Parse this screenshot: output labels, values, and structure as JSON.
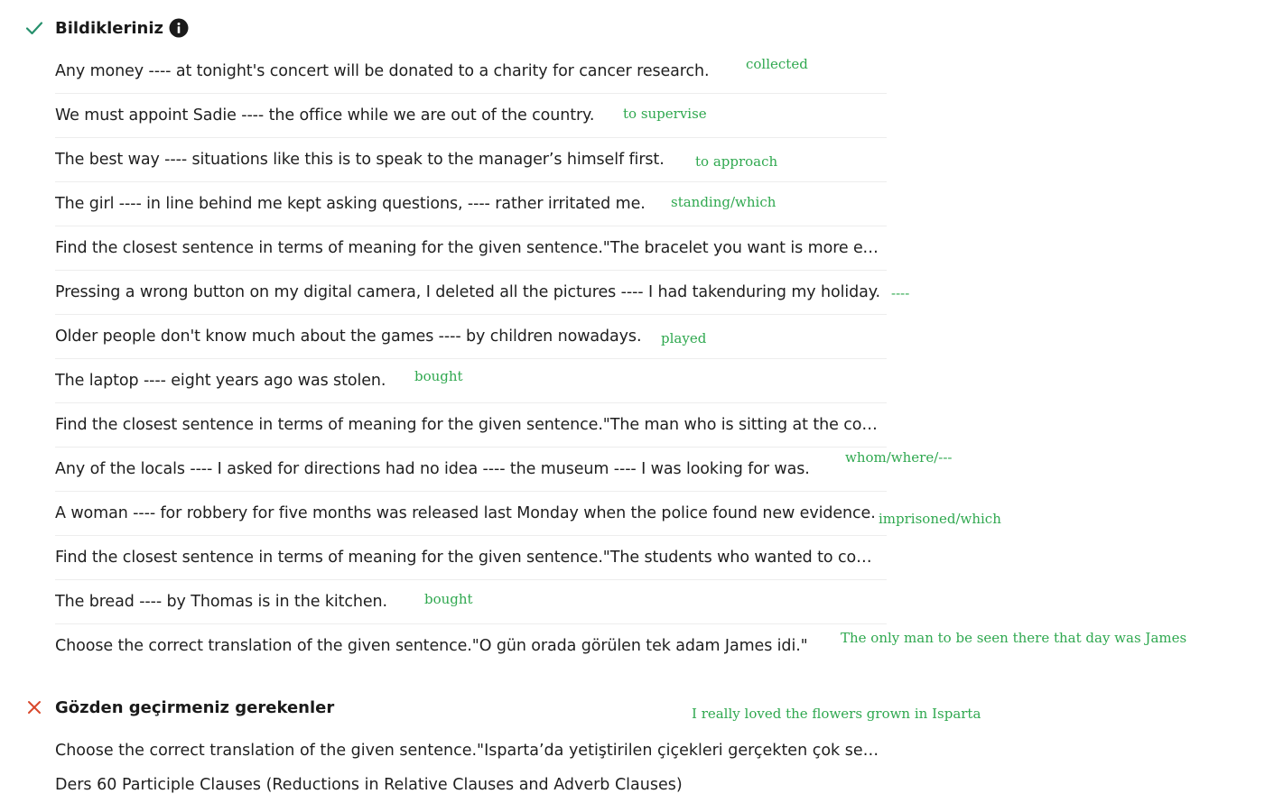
{
  "known_section": {
    "title": "Bildikleriniz",
    "check_icon": "check-icon",
    "info_icon": "info-icon",
    "accent_color": "#26906c"
  },
  "questions": [
    {
      "text": "Any money ---- at tonight's concert will be donated to a charity for cancer research.",
      "note": "collected"
    },
    {
      "text": "We must appoint Sadie ---- the office while we are out of the country.",
      "note": "to supervise"
    },
    {
      "text": "The best way ---- situations like this is to speak to the manager’s himself first.",
      "note": "to approach"
    },
    {
      "text": "The girl ---- in line behind me kept asking questions, ---- rather irritated me.",
      "note": "standing/which"
    },
    {
      "text": "Find the closest sentence in terms of meaning for the given sentence.\"The bracelet you want is more expensive than the one I have.\"",
      "note": ""
    },
    {
      "text": "Pressing a wrong button on my digital camera, I deleted all the pictures ---- I had takenduring my holiday.",
      "note": "----"
    },
    {
      "text": "Older people don't know much about the games ---- by children nowadays.",
      "note": "played"
    },
    {
      "text": "The laptop ---- eight years ago was stolen.",
      "note": "bought"
    },
    {
      "text": "Find the closest sentence in terms of meaning for the given sentence.\"The man who is sitting at the corner is my uncle.\"",
      "note": ""
    },
    {
      "text": "Any of the locals ---- I asked for directions had no idea ---- the museum ---- I was looking for was.",
      "note": "whom/where/---"
    },
    {
      "text": "A woman ---- for robbery for five months was released last Monday when the police found new evidence.",
      "note": "imprisoned/which"
    },
    {
      "text": "Find the closest sentence in terms of meaning for the given sentence.\"The students who wanted to complete the project stayed late.\"",
      "note": ""
    },
    {
      "text": "The bread ---- by Thomas is in the kitchen.",
      "note": "bought"
    },
    {
      "text": "Choose the correct translation of the given sentence.\"O gün orada görülen tek adam James idi.\"",
      "note": "The only man to be seen there that day was James"
    }
  ],
  "review_section": {
    "title": "Gözden geçirmeniz gerekenler",
    "cross_icon": "cross-icon",
    "accent_color": "#d9472b",
    "note": "I really loved the flowers grown in Isparta",
    "items": [
      "Choose the correct translation of the given sentence.\"Isparta’da yetiştirilen çiçekleri gerçekten çok sevdim.\"",
      "Ders 60 Participle Clauses (Reductions in Relative Clauses and Adverb Clauses)"
    ]
  },
  "note_color": "#2fa84f"
}
